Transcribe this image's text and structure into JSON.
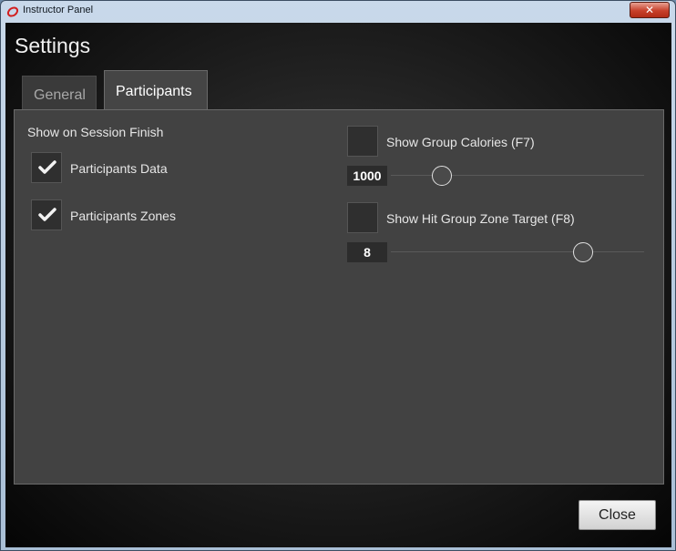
{
  "window": {
    "title": "Instructor Panel",
    "close_glyph": "✕"
  },
  "header": {
    "title": "Settings"
  },
  "tabs": [
    {
      "label": "General",
      "active": false
    },
    {
      "label": "Participants",
      "active": true
    }
  ],
  "left": {
    "section_label": "Show on Session Finish",
    "options": [
      {
        "label": "Participants Data",
        "checked": true
      },
      {
        "label": "Participants Zones",
        "checked": true
      }
    ]
  },
  "right": {
    "group_calories": {
      "label": "Show Group Calories (F7)",
      "checked": false,
      "value": "1000",
      "slider_fraction": 0.2
    },
    "hit_zone_target": {
      "label": "Show Hit Group Zone Target (F8)",
      "checked": false,
      "value": "8",
      "slider_fraction": 0.76
    }
  },
  "footer": {
    "close_label": "Close"
  },
  "colors": {
    "panel_bg": "#424242",
    "accent_red": "#c7402a"
  }
}
